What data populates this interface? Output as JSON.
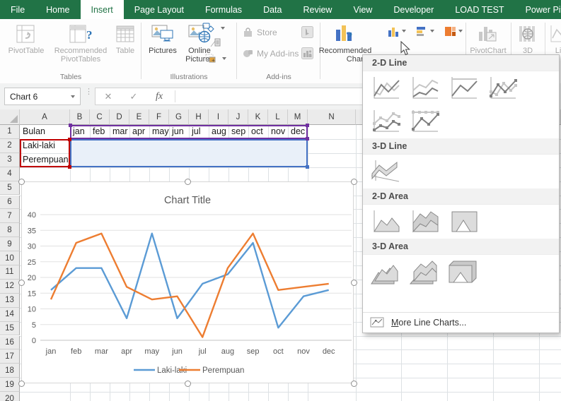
{
  "colors": {
    "excel_green": "#217346",
    "range_series_names": "#c00000",
    "range_categories": "#7030a0",
    "range_values": "#4472c4",
    "selection_fill": "#e9f0f9"
  },
  "ribbon": {
    "tabs": [
      {
        "label": "File",
        "active": false
      },
      {
        "label": "Home",
        "active": false
      },
      {
        "label": "Insert",
        "active": true
      },
      {
        "label": "Page Layout",
        "active": false
      },
      {
        "label": "Formulas",
        "active": false
      },
      {
        "label": "Data",
        "active": false
      },
      {
        "label": "Review",
        "active": false
      },
      {
        "label": "View",
        "active": false
      },
      {
        "label": "Developer",
        "active": false
      },
      {
        "label": "LOAD TEST",
        "active": false
      },
      {
        "label": "Power Pivot",
        "active": false
      }
    ],
    "tables_group": {
      "label": "Tables",
      "pivottable": "PivotTable",
      "recommended_pivottables": "Recommended PivotTables",
      "table": "Table"
    },
    "illustrations_group": {
      "label": "Illustrations",
      "pictures": "Pictures",
      "online_pictures": "Online Pictures"
    },
    "addins_group": {
      "label": "Add-ins",
      "store": "Store",
      "my_addins": "My Add-ins"
    },
    "charts_group": {
      "recommended_line1": "Recommended",
      "recommended_line2": "Charts"
    },
    "pivotchart_label": "PivotChart",
    "map3d_label": "3D",
    "sparkline_label": "Li"
  },
  "formula_bar": {
    "name_box": "Chart 6",
    "cancel_icon": "✕",
    "enter_icon": "✓",
    "fx_icon": "fx",
    "formula_value": ""
  },
  "sheet": {
    "columns": [
      "A",
      "B",
      "C",
      "D",
      "E",
      "F",
      "G",
      "H",
      "I",
      "J",
      "K",
      "L",
      "M",
      "N"
    ],
    "visible_row_count": 20,
    "header_label": "Bulan"
  },
  "chart_data": {
    "type": "line",
    "title": "Chart Title",
    "categories": [
      "jan",
      "feb",
      "mar",
      "apr",
      "may",
      "jun",
      "jul",
      "aug",
      "sep",
      "oct",
      "nov",
      "dec"
    ],
    "series": [
      {
        "name": "Laki-laki",
        "color": "#5B9BD5",
        "values": [
          16,
          23,
          23,
          7,
          34,
          7,
          18,
          21,
          31,
          4,
          14,
          16
        ]
      },
      {
        "name": "Perempuan",
        "color": "#ED7D31",
        "values": [
          13,
          31,
          34,
          17,
          13,
          14,
          1,
          23,
          34,
          16,
          17,
          18
        ]
      }
    ],
    "ylim": [
      0,
      40
    ],
    "ytick_step": 5,
    "grid": true,
    "legend_position": "bottom"
  },
  "gallery": {
    "sections": [
      {
        "title": "2-D Line",
        "icons": [
          "line",
          "stacked-line",
          "line-100",
          "line-markers",
          "stacked-line-markers",
          "line-100-markers"
        ]
      },
      {
        "title": "3-D Line",
        "icons": [
          "line-3d"
        ]
      },
      {
        "title": "2-D Area",
        "icons": [
          "area",
          "stacked-area",
          "area-100"
        ]
      },
      {
        "title": "3-D Area",
        "icons": [
          "area-3d",
          "stacked-area-3d",
          "area-100-3d"
        ]
      }
    ],
    "footer": "More Line Charts..."
  }
}
